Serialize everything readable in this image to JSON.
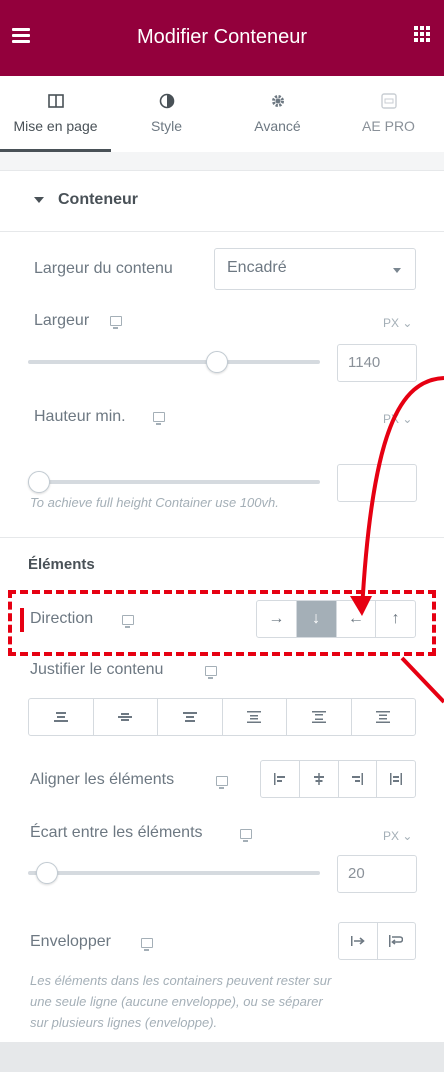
{
  "header": {
    "title": "Modifier Conteneur"
  },
  "tabs": [
    {
      "label": "Mise en page",
      "icon": "layout-icon",
      "active": true
    },
    {
      "label": "Style",
      "icon": "contrast-icon"
    },
    {
      "label": "Avancé",
      "icon": "gear-icon"
    },
    {
      "label": "AE PRO",
      "icon": "ae-pro-icon"
    }
  ],
  "section": {
    "title": "Conteneur"
  },
  "content_width": {
    "label": "Largeur du contenu",
    "value": "Encadré"
  },
  "width": {
    "label": "Largeur",
    "unit": "PX",
    "value": "1140",
    "slider_fraction": 0.66
  },
  "min_height": {
    "label": "Hauteur min.",
    "unit": "PX",
    "value": "",
    "slider_fraction": 0.0,
    "hint": "To achieve full height Container use 100vh."
  },
  "elements": {
    "title": "Éléments",
    "direction": {
      "label": "Direction",
      "options": [
        "→",
        "↓",
        "←",
        "↑"
      ],
      "active_index": 1
    },
    "justify": {
      "label": "Justifier le contenu"
    },
    "align": {
      "label": "Aligner les éléments"
    },
    "gap": {
      "label": "Écart entre les éléments",
      "unit": "PX",
      "value": "20",
      "slider_fraction": 0.03
    },
    "wrap": {
      "label": "Envelopper",
      "hint_lines": [
        "Les éléments dans les containers peuvent rester sur",
        "une seule ligne (aucune enveloppe), ou se séparer",
        "sur plusieurs lignes (enveloppe)."
      ]
    }
  },
  "colors": {
    "header": "#93003c",
    "highlight": "#e60012",
    "active_button": "#a4afb7"
  }
}
